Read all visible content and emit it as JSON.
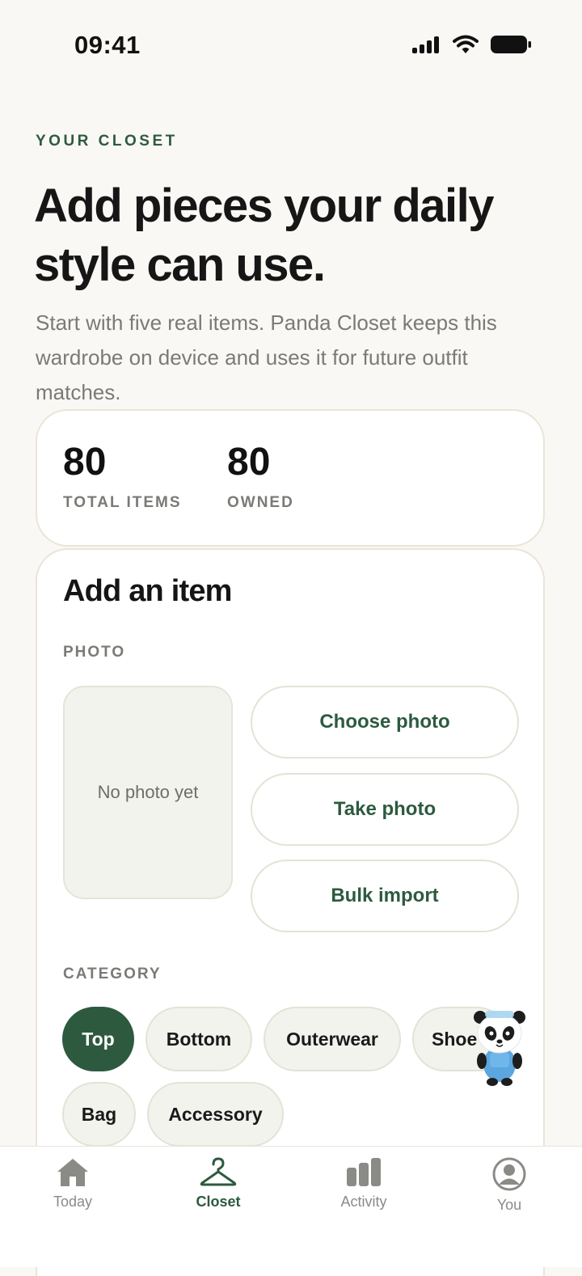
{
  "status_bar": {
    "time": "09:41"
  },
  "header": {
    "eyebrow": "YOUR CLOSET",
    "title": "Add pieces your daily style can use.",
    "subtitle": "Start with five real items. Panda Closet keeps this wardrobe on device and uses it for future outfit matches."
  },
  "stats": [
    {
      "value": "80",
      "label": "TOTAL ITEMS"
    },
    {
      "value": "80",
      "label": "OWNED"
    }
  ],
  "add_item": {
    "title": "Add an item",
    "photo_label": "PHOTO",
    "placeholder": "No photo yet",
    "buttons": [
      "Choose photo",
      "Take photo",
      "Bulk import"
    ],
    "category_label": "CATEGORY",
    "categories": [
      "Top",
      "Bottom",
      "Outerwear",
      "Shoe",
      "Bag",
      "Accessory"
    ],
    "selected_category": "Top"
  },
  "tabs": [
    {
      "label": "Today",
      "icon": "house-icon"
    },
    {
      "label": "Closet",
      "icon": "hanger-icon",
      "active": true
    },
    {
      "label": "Activity",
      "icon": "bar-chart-icon"
    },
    {
      "label": "You",
      "icon": "person-icon"
    }
  ],
  "colors": {
    "accent": "#2d5a3f",
    "background": "#f9f8f4",
    "chip": "#f3f3ee"
  }
}
